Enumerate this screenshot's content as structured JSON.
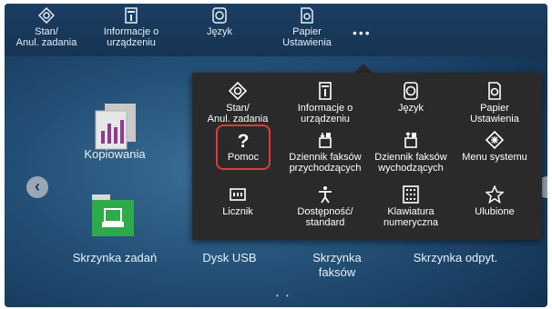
{
  "topbar": {
    "items": [
      {
        "label": "Stan/\nAnul. zadania",
        "icon": "status-icon"
      },
      {
        "label": "Informacje o\nurządzeniu",
        "icon": "device-info-icon"
      },
      {
        "label": "Język",
        "icon": "language-icon"
      },
      {
        "label": "Papier\nUstawienia",
        "icon": "paper-settings-icon"
      }
    ],
    "more_label": "•••"
  },
  "home": {
    "tiles": [
      {
        "label": "Kopiowania",
        "icon": "copy-icon"
      },
      {
        "label": "Skrzynka zadań",
        "icon": "job-box-icon"
      },
      {
        "label": "Dysk USB",
        "icon": "usb-drive-icon"
      },
      {
        "label": "Skrzynka\nfaksów",
        "icon": "fax-box-icon"
      },
      {
        "label": "Skrzynka odpyt.",
        "icon": "polling-box-icon"
      }
    ],
    "nav_left": "‹",
    "page_indicator": "• •"
  },
  "popup": {
    "items": [
      {
        "label": "Stan/\nAnul. zadania",
        "icon": "status-icon"
      },
      {
        "label": "Informacje o\nurządzeniu",
        "icon": "device-info-icon"
      },
      {
        "label": "Język",
        "icon": "language-icon"
      },
      {
        "label": "Papier\nUstawienia",
        "icon": "paper-settings-icon"
      },
      {
        "label": "Pomoc",
        "icon": "help-icon",
        "highlighted": true
      },
      {
        "label": "Dziennik faksów\nprzychodzących",
        "icon": "incoming-fax-log-icon"
      },
      {
        "label": "Dziennik faksów\nwychodzących",
        "icon": "outgoing-fax-log-icon"
      },
      {
        "label": "Menu systemu",
        "icon": "system-menu-icon"
      },
      {
        "label": "Licznik",
        "icon": "counter-icon"
      },
      {
        "label": "Dostępność/\nstandard",
        "icon": "accessibility-icon"
      },
      {
        "label": "Klawiatura\nnumeryczna",
        "icon": "numeric-keypad-icon"
      },
      {
        "label": "Ulubione",
        "icon": "favorites-icon"
      }
    ],
    "highlight_color": "#e03a3a"
  }
}
